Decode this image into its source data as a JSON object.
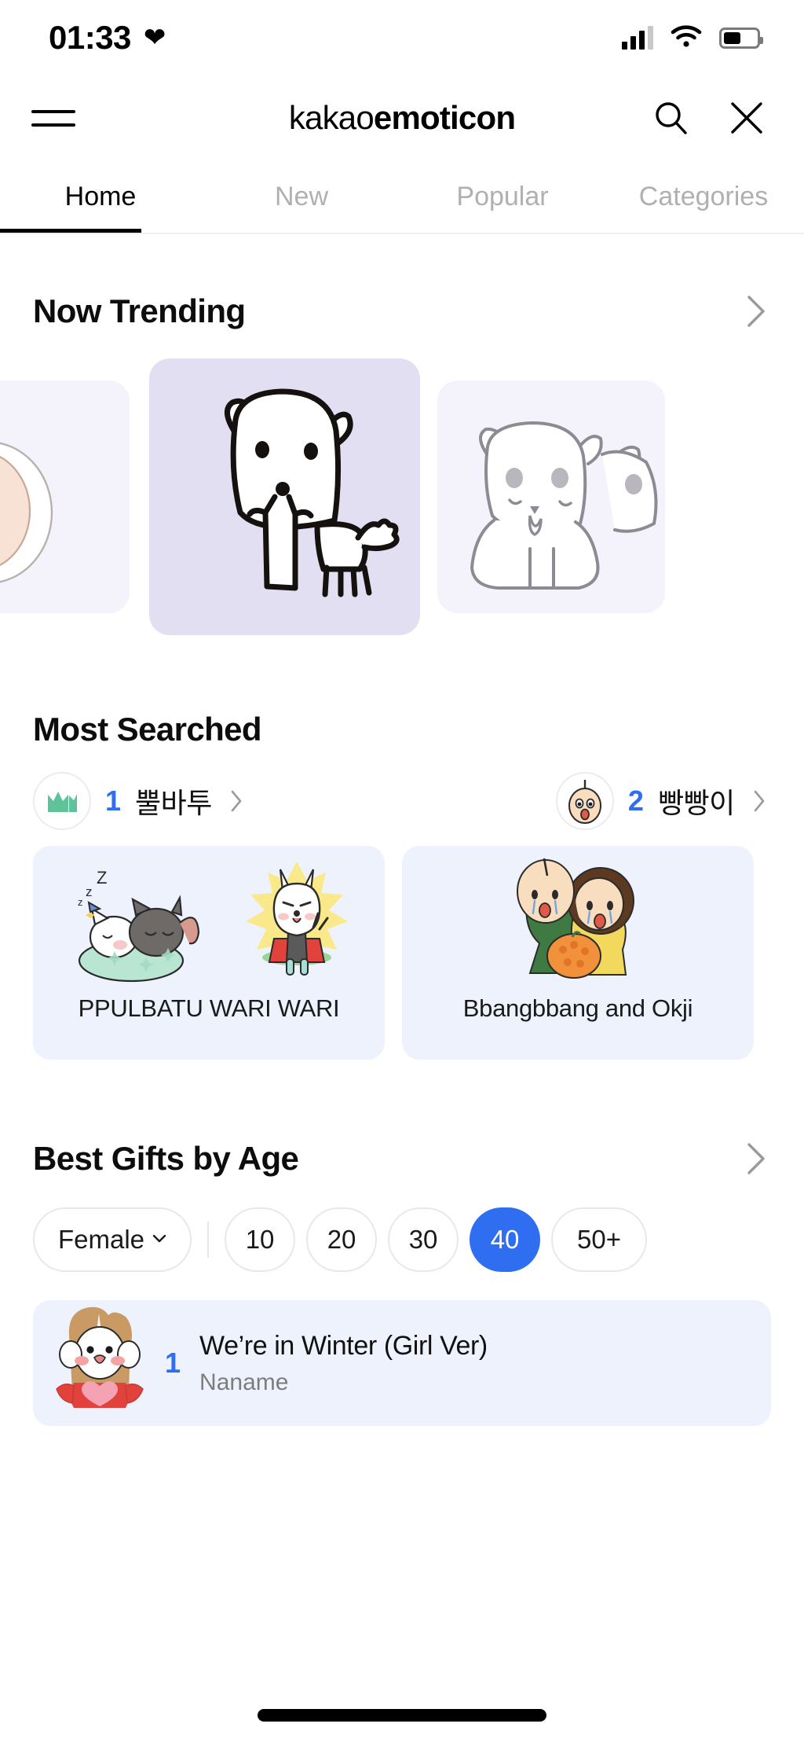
{
  "status_bar": {
    "time": "01:33",
    "heart_icon": "heart-icon",
    "signal_icon": "signal-bars-icon",
    "wifi_icon": "wifi-icon",
    "battery_icon": "battery-icon",
    "battery_level_percent": 52
  },
  "app_bar": {
    "menu_icon": "hamburger-menu-icon",
    "brand_thin": "kakao",
    "brand_bold": "emoticon",
    "search_icon": "search-icon",
    "close_icon": "close-icon"
  },
  "tabs": {
    "items": [
      {
        "label": "Home",
        "active": true
      },
      {
        "label": "New",
        "active": false
      },
      {
        "label": "Popular",
        "active": false
      },
      {
        "label": "Categories",
        "active": false
      }
    ]
  },
  "trending": {
    "title": "Now Trending",
    "more_icon": "chevron-right-icon",
    "cards": [
      {
        "name": "trending-card-peek-left",
        "bg": "#f4f2fa"
      },
      {
        "name": "trending-card-featured",
        "bg": "#e3dff3"
      },
      {
        "name": "trending-card-peek-right",
        "bg": "#f4f2fa"
      }
    ]
  },
  "most_searched": {
    "title": "Most Searched",
    "ranks": [
      {
        "rank": "1",
        "name": "뿔바투",
        "avatar_icon": "crown-avatar-icon",
        "chevron_icon": "chevron-right-icon"
      },
      {
        "rank": "2",
        "name": "빵빵이",
        "avatar_icon": "baby-face-avatar-icon",
        "chevron_icon": "chevron-right-icon"
      }
    ],
    "cards": [
      {
        "label": "PPULBATU WARI WARI"
      },
      {
        "label": "Bbangbbang and Okji"
      }
    ]
  },
  "best_gifts": {
    "title": "Best Gifts by Age",
    "more_icon": "chevron-right-icon",
    "gender_filter": {
      "label": "Female",
      "caret_icon": "chevron-down-icon"
    },
    "age_chips": [
      {
        "label": "10",
        "selected": false
      },
      {
        "label": "20",
        "selected": false
      },
      {
        "label": "30",
        "selected": false
      },
      {
        "label": "40",
        "selected": true
      },
      {
        "label": "50+",
        "selected": false
      }
    ],
    "accent_color": "#2f6ef0",
    "items": [
      {
        "rank": "1",
        "title": "We’re in Winter (Girl Ver)",
        "subtitle": "Naname"
      }
    ]
  }
}
